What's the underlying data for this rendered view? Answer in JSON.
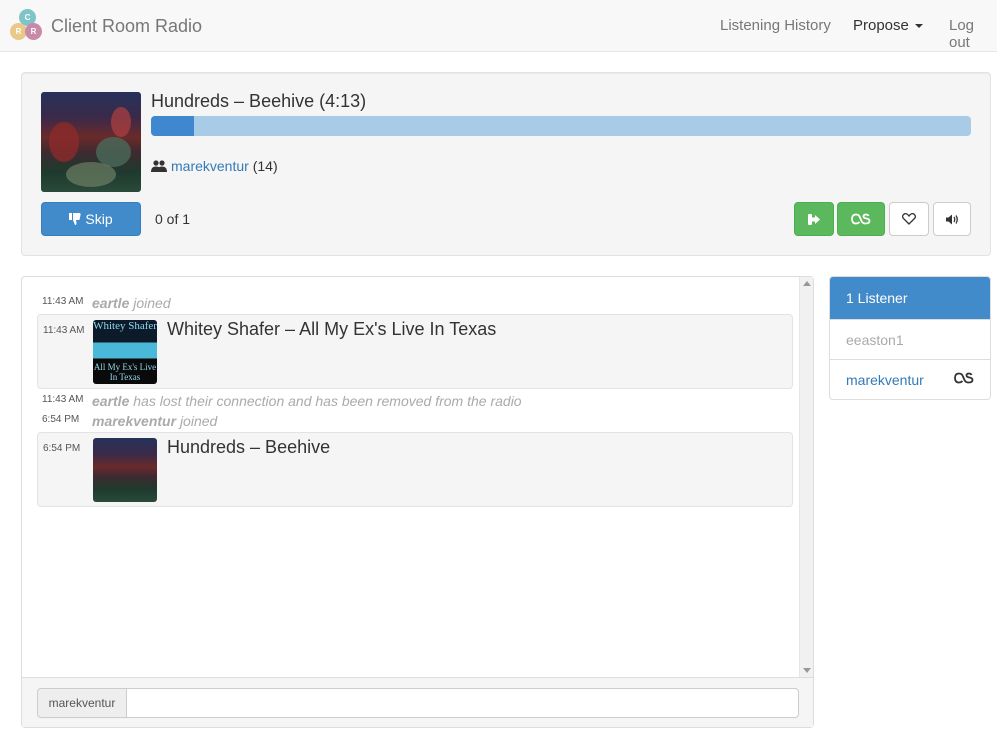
{
  "app": {
    "title": "Client Room Radio",
    "logo_letters": [
      "C",
      "R",
      "R"
    ]
  },
  "nav": {
    "history_label": "Listening History",
    "propose_label": "Propose",
    "logout_label": "Log out"
  },
  "now_playing": {
    "title": "Hundreds – Beehive (4:13)",
    "progress_fraction": 0.052,
    "submitter": "marekventur",
    "submitter_count": "(14)",
    "skip_label": "Skip",
    "votes": "0 of 1"
  },
  "chat": {
    "messages": [
      {
        "time": "11:43 AM",
        "user": "eartle",
        "text": "joined"
      },
      {
        "time": "11:43 AM",
        "track": "Whitey Shafer – All My Ex's Live In Texas",
        "art_text_top": "Whitey Shafer",
        "art_text_bottom": "All My Ex's Live In Texas"
      },
      {
        "time": "11:43 AM",
        "user": "eartle",
        "text": "has lost their connection and has been removed from the radio"
      },
      {
        "time": "6:54 PM",
        "user": "marekventur",
        "text": "joined"
      },
      {
        "time": "6:54 PM",
        "track": "Hundreds – Beehive"
      }
    ],
    "input_user": "marekventur",
    "input_value": ""
  },
  "listeners": {
    "header": "1 Listener",
    "items": [
      {
        "name": "eeaston1",
        "status": "idle"
      },
      {
        "name": "marekventur",
        "status": "active",
        "icon": "lastfm-icon"
      }
    ]
  },
  "colors": {
    "primary": "#428bca",
    "success": "#5cb85c",
    "progress_bg": "#a8cce8",
    "link": "#337ab7"
  }
}
